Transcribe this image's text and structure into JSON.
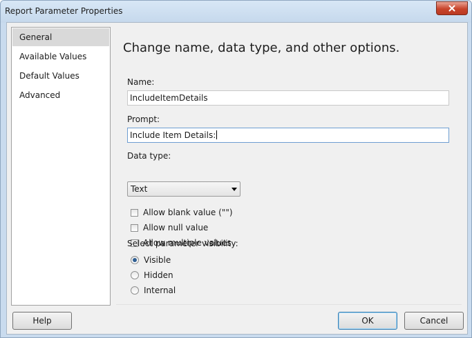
{
  "window": {
    "title": "Report Parameter Properties"
  },
  "nav": {
    "items": [
      {
        "label": "General",
        "selected": true
      },
      {
        "label": "Available Values",
        "selected": false
      },
      {
        "label": "Default Values",
        "selected": false
      },
      {
        "label": "Advanced",
        "selected": false
      }
    ]
  },
  "content": {
    "heading": "Change name, data type, and other options.",
    "name_label": "Name:",
    "name_value": "IncludeItemDetails",
    "prompt_label": "Prompt:",
    "prompt_value": "Include Item Details:",
    "datatype_label": "Data type:",
    "datatype_value": "Text",
    "checkboxes": [
      {
        "label": "Allow blank value (\"\")",
        "checked": false
      },
      {
        "label": "Allow null value",
        "checked": false
      },
      {
        "label": "Allow multiple values",
        "checked": false
      }
    ],
    "visibility_label": "Select parameter visibility:",
    "visibility_options": [
      {
        "label": "Visible",
        "checked": true
      },
      {
        "label": "Hidden",
        "checked": false
      },
      {
        "label": "Internal",
        "checked": false
      }
    ]
  },
  "buttons": {
    "help": "Help",
    "ok": "OK",
    "cancel": "Cancel"
  },
  "icons": {
    "close": "close-icon",
    "dropdown": "chevron-down-icon"
  }
}
